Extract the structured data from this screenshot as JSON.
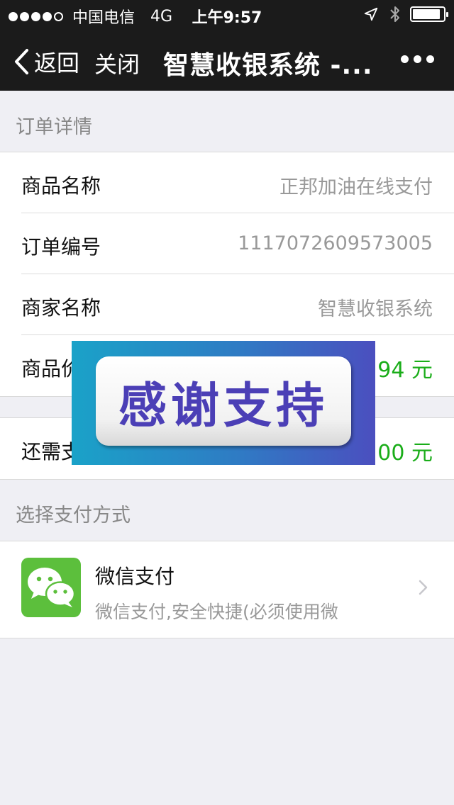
{
  "status": {
    "carrier": "中国电信",
    "network": "4G",
    "time": "上午9:57",
    "signal_bars": 4,
    "signal_max": 5,
    "battery_level": 0.9
  },
  "nav": {
    "back_label": "返回",
    "close_label": "关闭",
    "title": "智慧收银系统 -..."
  },
  "order_section": {
    "header": "订单详情",
    "rows": [
      {
        "label": "商品名称",
        "value": "正邦加油在线支付"
      },
      {
        "label": "订单编号",
        "value": "1117072609573005"
      },
      {
        "label": "商家名称",
        "value": "智慧收银系统"
      },
      {
        "label": "商品价",
        "value": "94 元"
      }
    ]
  },
  "due_row": {
    "label": "还需支",
    "value": "00 元"
  },
  "payment_section": {
    "header": "选择支付方式",
    "method": {
      "title": "微信支付",
      "description": "微信支付,安全快捷(必须使用微"
    }
  },
  "overlay": {
    "text": "感谢支持"
  },
  "colors": {
    "nav_bg": "#1b1b1b",
    "page_bg": "#efeff4",
    "green": "#1aad19",
    "wechat_green": "#5cbf3c",
    "overlay_text": "#4b3fb6"
  }
}
